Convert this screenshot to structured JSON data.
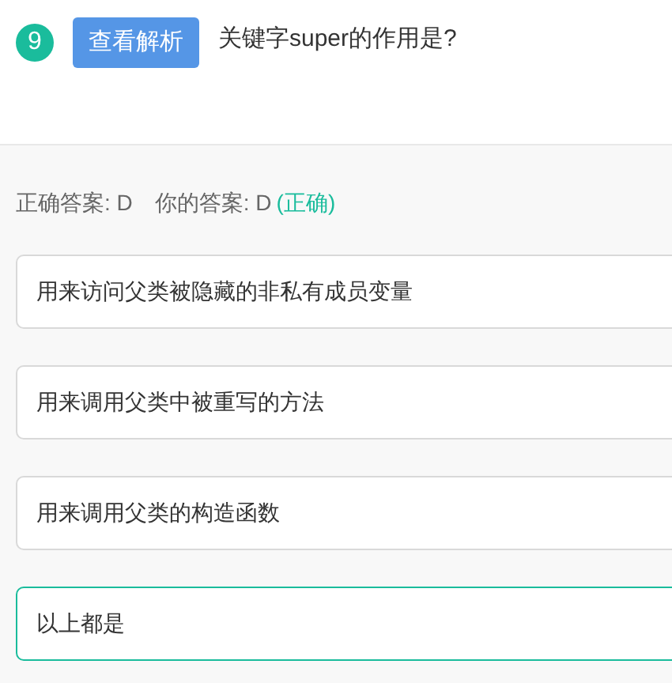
{
  "question": {
    "number": "9",
    "button": "查看解析",
    "text": "关键字super的作用是?"
  },
  "result": {
    "correct_answer": "正确答案: D",
    "your_answer": "你的答案: D",
    "verdict": "(正确)"
  },
  "options": [
    {
      "text": "用来访问父类被隐藏的非私有成员变量",
      "selected": false
    },
    {
      "text": "用来调用父类中被重写的方法",
      "selected": false
    },
    {
      "text": "用来调用父类的构造函数",
      "selected": false
    },
    {
      "text": "以上都是",
      "selected": true
    }
  ]
}
